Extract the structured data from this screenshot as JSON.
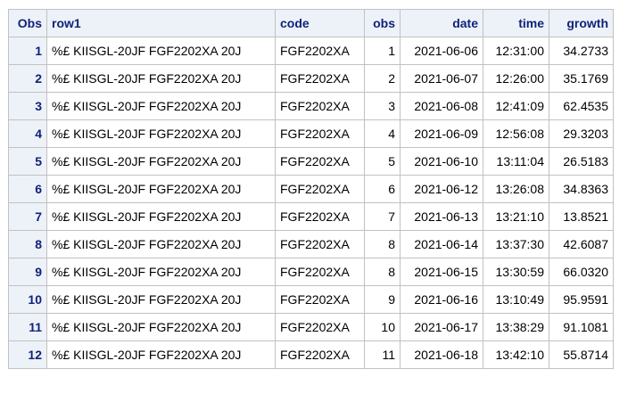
{
  "table": {
    "headers": [
      "Obs",
      "row1",
      "code",
      "obs",
      "date",
      "time",
      "growth"
    ],
    "rows": [
      [
        "1",
        "%£ KIISGL-20JF FGF2202XA 20J",
        "FGF2202XA",
        "1",
        "2021-06-06",
        "12:31:00",
        "34.2733"
      ],
      [
        "2",
        "%£ KIISGL-20JF FGF2202XA 20J",
        "FGF2202XA",
        "2",
        "2021-06-07",
        "12:26:00",
        "35.1769"
      ],
      [
        "3",
        "%£ KIISGL-20JF FGF2202XA 20J",
        "FGF2202XA",
        "3",
        "2021-06-08",
        "12:41:09",
        "62.4535"
      ],
      [
        "4",
        "%£ KIISGL-20JF FGF2202XA 20J",
        "FGF2202XA",
        "4",
        "2021-06-09",
        "12:56:08",
        "29.3203"
      ],
      [
        "5",
        "%£ KIISGL-20JF FGF2202XA 20J",
        "FGF2202XA",
        "5",
        "2021-06-10",
        "13:11:04",
        "26.5183"
      ],
      [
        "6",
        "%£ KIISGL-20JF FGF2202XA 20J",
        "FGF2202XA",
        "6",
        "2021-06-12",
        "13:26:08",
        "34.8363"
      ],
      [
        "7",
        "%£ KIISGL-20JF FGF2202XA 20J",
        "FGF2202XA",
        "7",
        "2021-06-13",
        "13:21:10",
        "13.8521"
      ],
      [
        "8",
        "%£ KIISGL-20JF FGF2202XA 20J",
        "FGF2202XA",
        "8",
        "2021-06-14",
        "13:37:30",
        "42.6087"
      ],
      [
        "9",
        "%£ KIISGL-20JF FGF2202XA 20J",
        "FGF2202XA",
        "8",
        "2021-06-15",
        "13:30:59",
        "66.0320"
      ],
      [
        "10",
        "%£ KIISGL-20JF FGF2202XA 20J",
        "FGF2202XA",
        "9",
        "2021-06-16",
        "13:10:49",
        "95.9591"
      ],
      [
        "11",
        "%£ KIISGL-20JF FGF2202XA 20J",
        "FGF2202XA",
        "10",
        "2021-06-17",
        "13:38:29",
        "91.1081"
      ],
      [
        "12",
        "%£ KIISGL-20JF FGF2202XA 20J",
        "FGF2202XA",
        "11",
        "2021-06-18",
        "13:42:10",
        "55.8714"
      ]
    ]
  }
}
